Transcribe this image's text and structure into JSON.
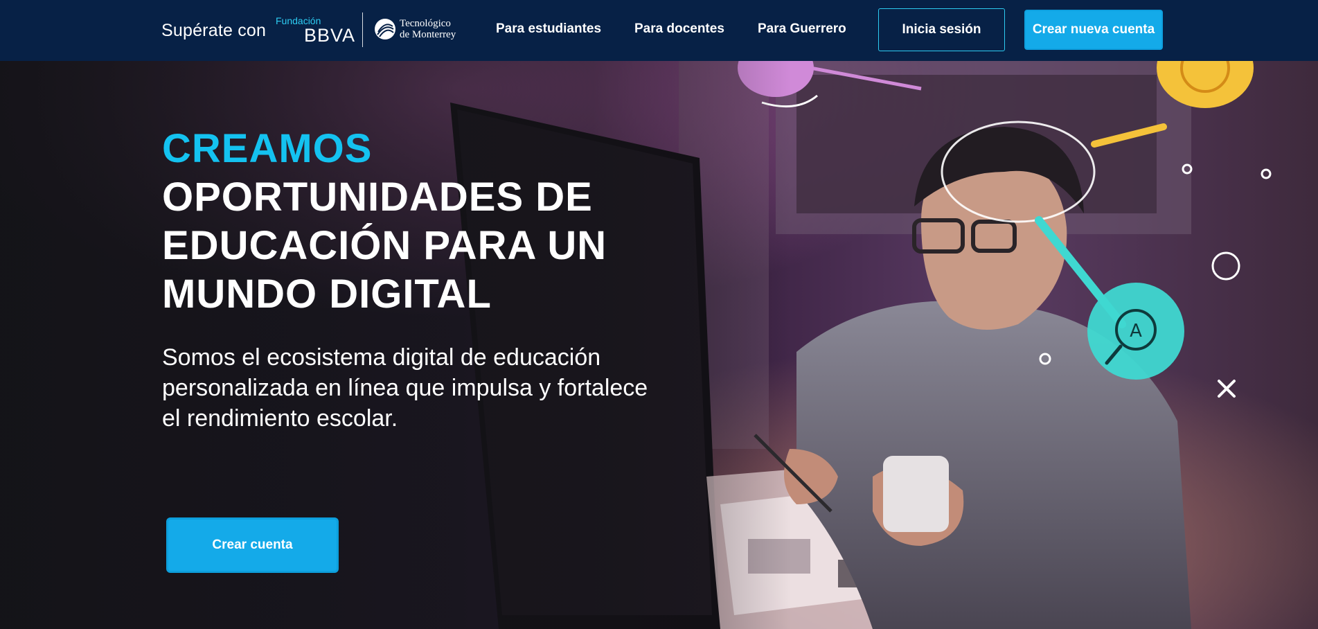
{
  "header": {
    "brand_text": "Supérate con",
    "fundacion_label": "Fundación",
    "bbva_label": "BBVA",
    "tec_line1": "Tecnológico",
    "tec_line2": "de Monterrey",
    "nav": [
      {
        "label": "Para estudiantes"
      },
      {
        "label": "Para docentes"
      },
      {
        "label": "Para Guerrero"
      }
    ],
    "login_label": "Inicia sesión",
    "signup_label": "Crear nueva cuenta"
  },
  "hero": {
    "headline_accent": "CREAMOS",
    "headline_main": "OPORTUNIDADES DE EDUCACIÓN PARA UN MUNDO DIGITAL",
    "subtitle": "Somos el ecosistema digital de educación personalizada en línea que impulsa y fortalece el rendimiento escolar.",
    "cta_label": "Crear cuenta",
    "magnifier_letter": "A"
  },
  "colors": {
    "header_bg": "#072146",
    "accent": "#14c2f0",
    "button": "#14aae9",
    "fundacion": "#2dccf2"
  },
  "icons": [
    "tec-globe-icon",
    "magnifier-a-icon",
    "close-x-icon"
  ]
}
